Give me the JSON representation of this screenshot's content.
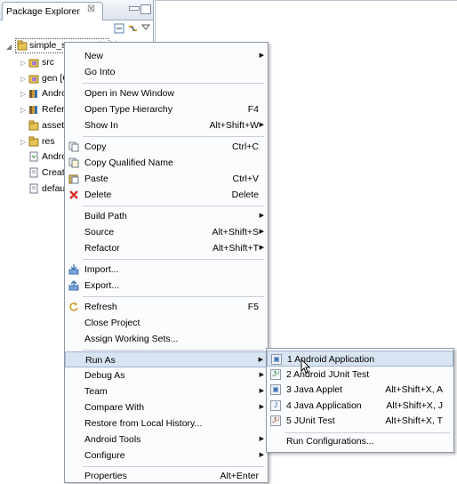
{
  "view": {
    "title": "Package Explorer",
    "close_glyph": "☒"
  },
  "tree": {
    "project": "simple_sync_android",
    "items": [
      {
        "label": "src",
        "icon": "package-folder-icon"
      },
      {
        "label": "gen [G",
        "icon": "package-folder-icon"
      },
      {
        "label": "Andro",
        "icon": "library-icon"
      },
      {
        "label": "Refere",
        "icon": "library-icon"
      },
      {
        "label": "assets",
        "icon": "folder-icon"
      },
      {
        "label": "res",
        "icon": "folder-icon"
      },
      {
        "label": "Andro",
        "icon": "xml-file-icon"
      },
      {
        "label": "Creati",
        "icon": "file-icon"
      },
      {
        "label": "defaul",
        "icon": "file-icon"
      }
    ]
  },
  "menu": {
    "new": "New",
    "go_into": "Go Into",
    "open_new_window": "Open in New Window",
    "open_type_hierarchy": "Open Type Hierarchy",
    "open_type_hierarchy_key": "F4",
    "show_in": "Show In",
    "show_in_key": "Alt+Shift+W",
    "copy": "Copy",
    "copy_key": "Ctrl+C",
    "copy_qualified": "Copy Qualified Name",
    "paste": "Paste",
    "paste_key": "Ctrl+V",
    "delete": "Delete",
    "delete_key": "Delete",
    "build_path": "Build Path",
    "source": "Source",
    "source_key": "Alt+Shift+S",
    "refactor": "Refactor",
    "refactor_key": "Alt+Shift+T",
    "import": "Import...",
    "export": "Export...",
    "refresh": "Refresh",
    "refresh_key": "F5",
    "close_project": "Close Project",
    "assign_working_sets": "Assign Working Sets...",
    "run_as": "Run As",
    "debug_as": "Debug As",
    "team": "Team",
    "compare_with": "Compare With",
    "restore_local": "Restore from Local History...",
    "android_tools": "Android Tools",
    "configure": "Configure",
    "properties": "Properties",
    "properties_key": "Alt+Enter",
    "arrow": "▶"
  },
  "submenu": {
    "items": [
      {
        "label": "1 Android Application",
        "key": ""
      },
      {
        "label": "2 Android JUnit Test",
        "key": ""
      },
      {
        "label": "3 Java Applet",
        "key": "Alt+Shift+X, A"
      },
      {
        "label": "4 Java Application",
        "key": "Alt+Shift+X, J"
      },
      {
        "label": "5 JUnit Test",
        "key": "Alt+Shift+X, T"
      }
    ],
    "run_configurations": "Run Configurations...",
    "icon_glyphs": [
      "▣",
      "Jᵁ",
      "▣",
      "J",
      "Jᵁ"
    ]
  },
  "colors": {
    "highlight": "#d9e4f2",
    "delete_icon": "#d8322a",
    "accent": "#3a6fb0"
  }
}
